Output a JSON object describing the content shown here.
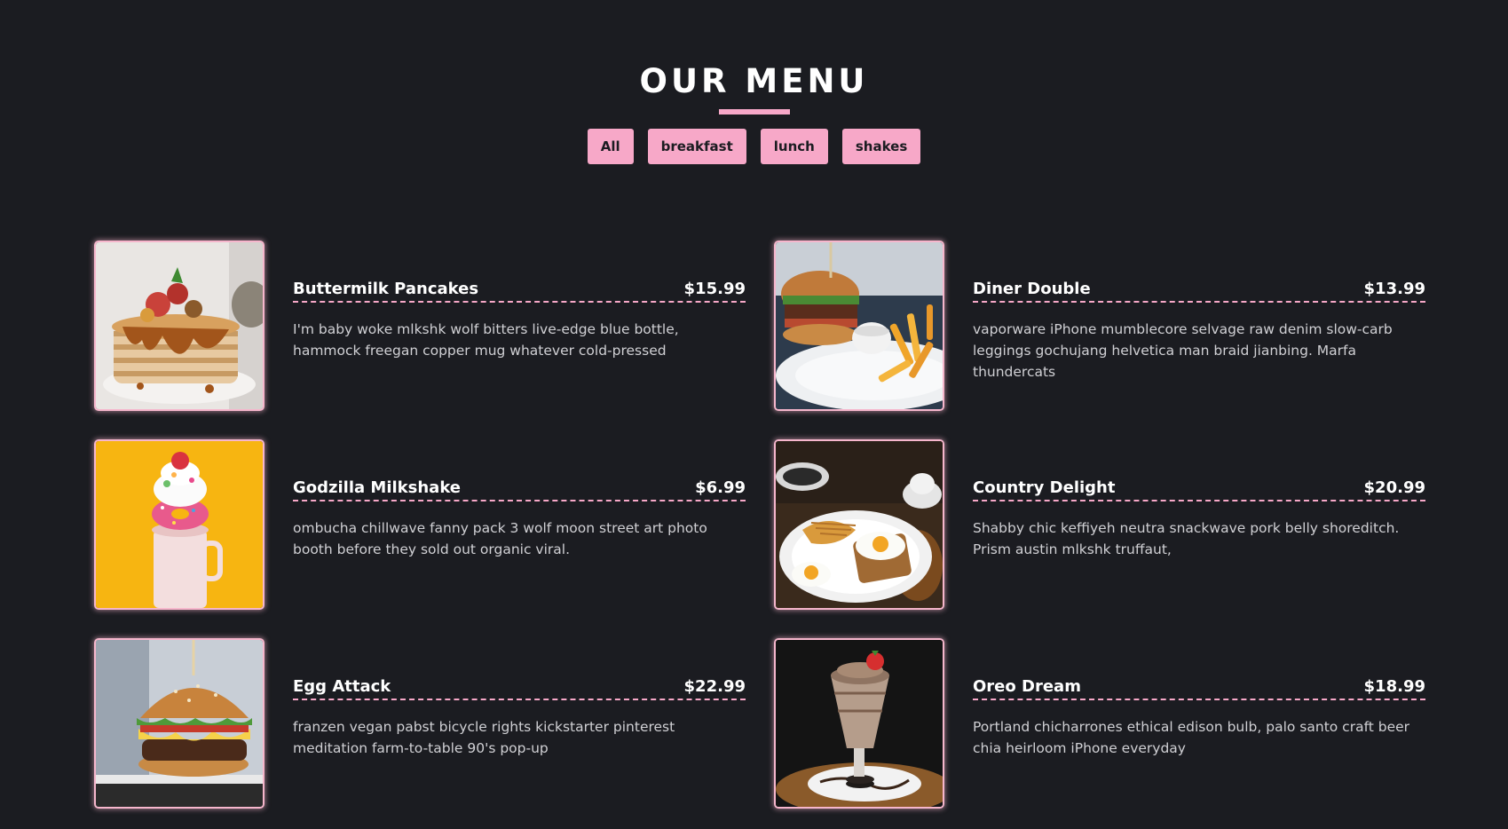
{
  "colors": {
    "background": "#1b1c21",
    "accent": "#f7a8c8",
    "text": "#ffffff",
    "muted_text": "#d0d0d4"
  },
  "header": {
    "title": "OUR MENU"
  },
  "filters": [
    {
      "label": "All"
    },
    {
      "label": "breakfast"
    },
    {
      "label": "lunch"
    },
    {
      "label": "shakes"
    }
  ],
  "items": [
    {
      "title": "Buttermilk Pancakes",
      "price": "$15.99",
      "desc": "I'm baby woke mlkshk wolf bitters live-edge blue bottle, hammock freegan copper mug whatever cold-pressed",
      "image_icon": "pancakes-image"
    },
    {
      "title": "Diner Double",
      "price": "$13.99",
      "desc": "vaporware iPhone mumblecore selvage raw denim slow-carb leggings gochujang helvetica man braid jianbing. Marfa thundercats",
      "image_icon": "burger-fries-image"
    },
    {
      "title": "Godzilla Milkshake",
      "price": "$6.99",
      "desc": "ombucha chillwave fanny pack 3 wolf moon street art photo booth before they sold out organic viral.",
      "image_icon": "milkshake-image"
    },
    {
      "title": "Country Delight",
      "price": "$20.99",
      "desc": "Shabby chic keffiyeh neutra snackwave pork belly shoreditch. Prism austin mlkshk truffaut,",
      "image_icon": "eggs-toast-image"
    },
    {
      "title": "Egg Attack",
      "price": "$22.99",
      "desc": "franzen vegan pabst bicycle rights kickstarter pinterest meditation farm-to-table 90's pop-up",
      "image_icon": "egg-burger-image"
    },
    {
      "title": "Oreo Dream",
      "price": "$18.99",
      "desc": "Portland chicharrones ethical edison bulb, palo santo craft beer chia heirloom iPhone everyday",
      "image_icon": "oreo-shake-image"
    }
  ]
}
